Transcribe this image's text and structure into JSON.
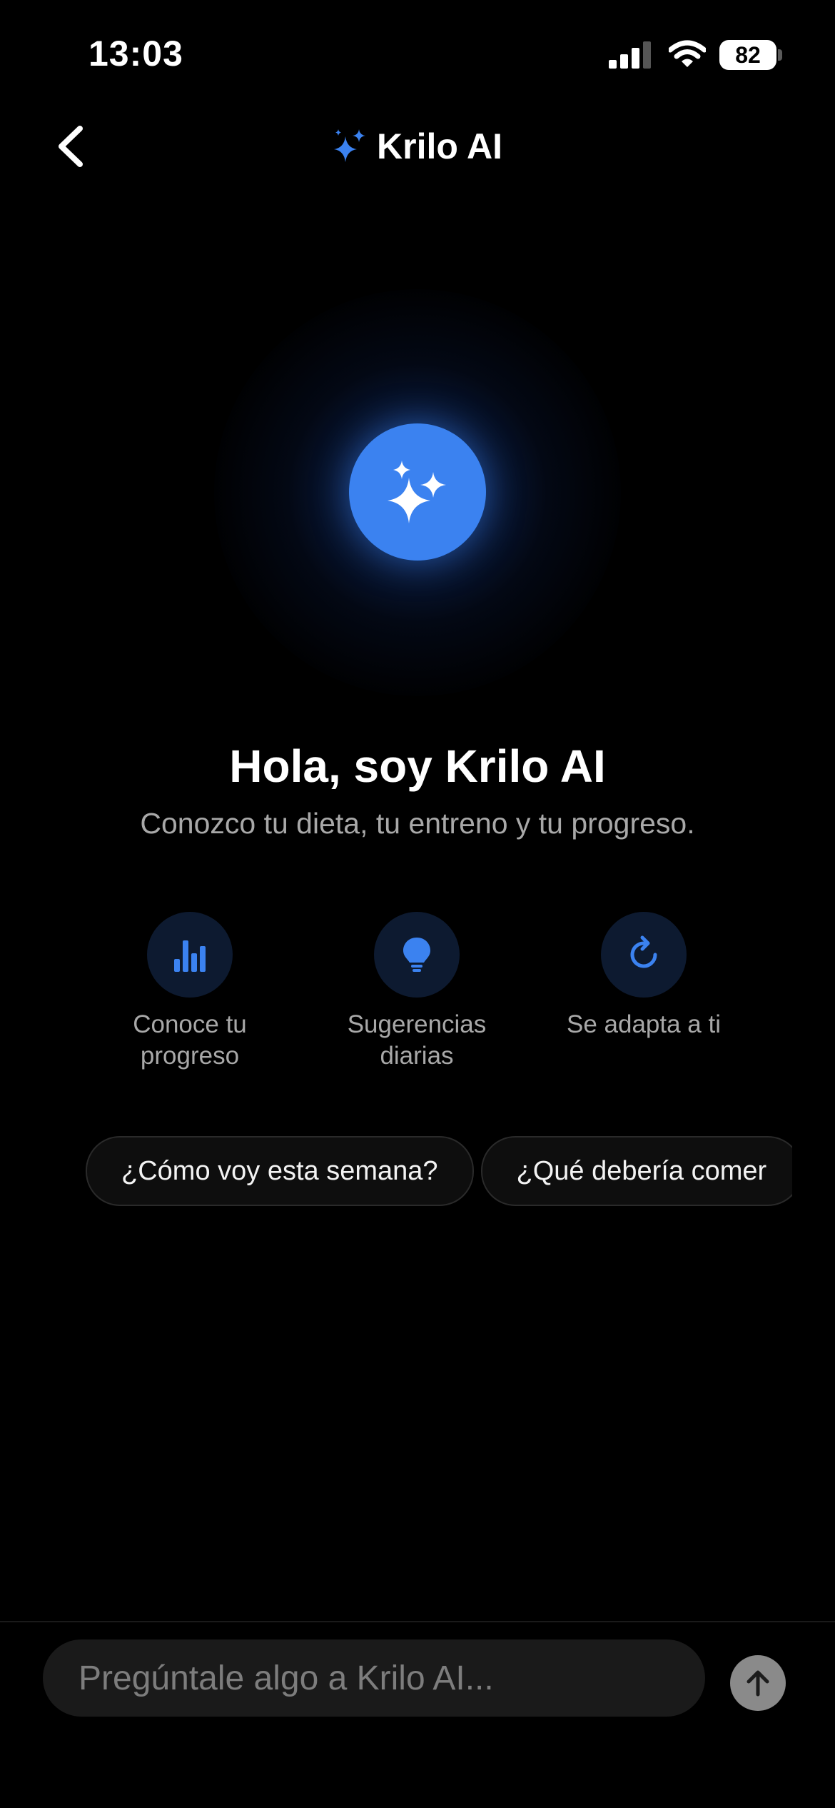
{
  "status_bar": {
    "time": "13:03",
    "battery": "82",
    "icons": [
      "signal-icon",
      "wifi-icon",
      "battery-icon"
    ]
  },
  "header": {
    "back_icon": "chevron-left-icon",
    "title_icon": "sparkles-icon",
    "title": "Krilo AI"
  },
  "hero": {
    "icon": "sparkles-icon",
    "greeting": "Hola, soy Krilo AI",
    "subtitle": "Conozco tu dieta, tu entreno y tu progreso."
  },
  "features": [
    {
      "icon": "bar-chart-icon",
      "label": "Conoce tu progreso"
    },
    {
      "icon": "lightbulb-icon",
      "label": "Sugerencias diarias"
    },
    {
      "icon": "refresh-icon",
      "label": "Se adapta a ti"
    }
  ],
  "suggestions": [
    "¿Cómo voy esta semana?",
    "¿Qué debería comer"
  ],
  "input": {
    "placeholder": "Pregúntale algo a Krilo AI...",
    "send_icon": "arrow-up-icon"
  },
  "colors": {
    "accent": "#3b82f0",
    "background": "#000000",
    "secondary_text": "#a8a8a8",
    "input_background": "#1a1a1a"
  }
}
